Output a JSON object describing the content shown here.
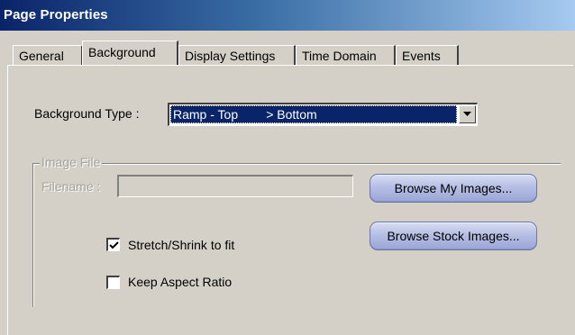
{
  "window": {
    "title": "Page Properties"
  },
  "tabs": [
    {
      "label": "General",
      "active": false
    },
    {
      "label": "Background",
      "active": true
    },
    {
      "label": "Display Settings",
      "active": false
    },
    {
      "label": "Time Domain",
      "active": false
    },
    {
      "label": "Events",
      "active": false
    }
  ],
  "background": {
    "type_label": "Background Type :",
    "type_value": "Ramp - Top        > Bottom",
    "image_file": {
      "group_label": "Image File",
      "filename_label": "Filename :",
      "filename_value": "",
      "browse_my_images": "Browse My Images...",
      "browse_stock_images": "Browse Stock Images..."
    },
    "stretch_label": "Stretch/Shrink to fit",
    "stretch_checked": true,
    "aspect_label": "Keep Aspect Ratio",
    "aspect_checked": false
  },
  "colors": {
    "title_gradient_start": "#0a246a",
    "title_gradient_end": "#a6caf0",
    "dialog_face": "#d4d0c8",
    "selection": "#0a246a",
    "button_pill": "#b6bfe4"
  }
}
